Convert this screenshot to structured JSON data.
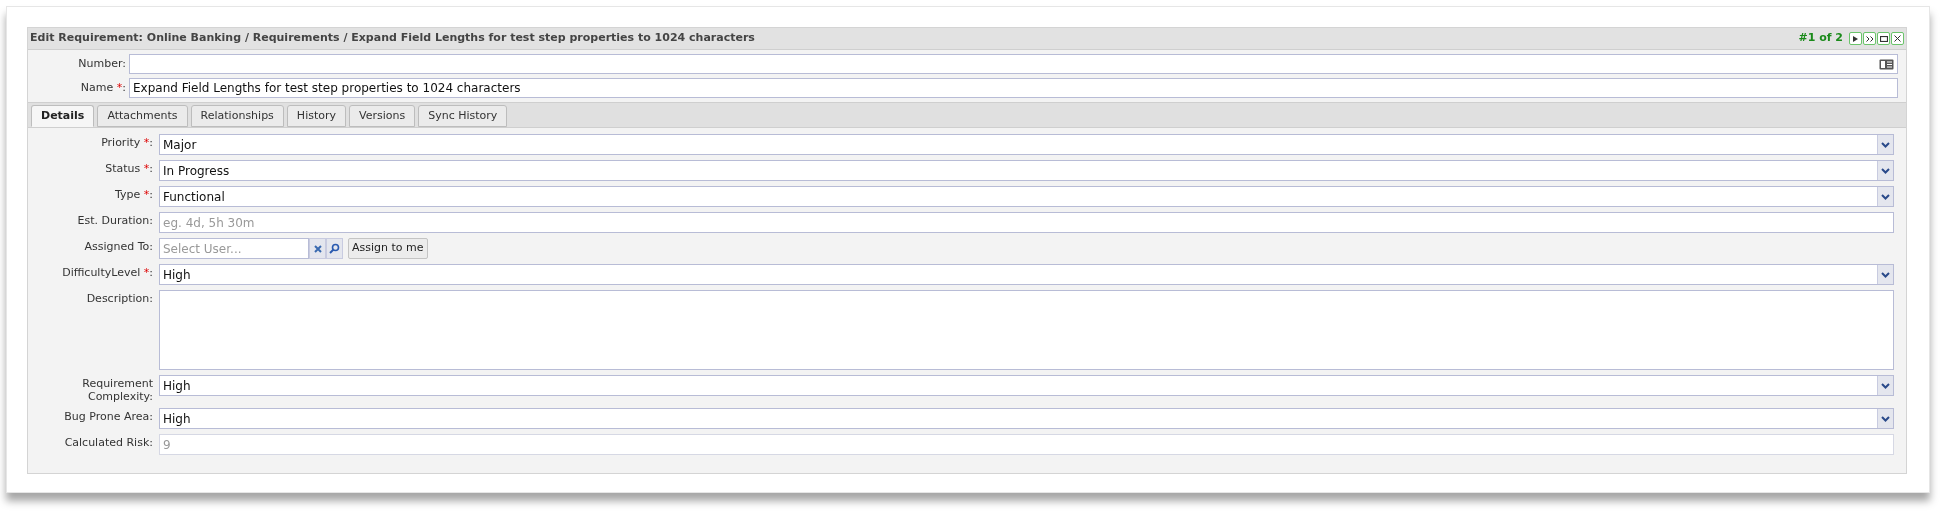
{
  "dialog": {
    "title": "Edit Requirement: Online Banking / Requirements / Expand Field Lengths for test step properties to 1024 characters",
    "counter": "#1 of 2"
  },
  "header_fields": [
    {
      "label": "Number:",
      "has_icon": true
    },
    {
      "label": "Name ",
      "asterisk": "*",
      "colon": ":",
      "value": "Expand Field Lengths for test step properties to 1024 characters",
      "has_icon": false
    }
  ],
  "tabs": [
    {
      "label": "Details",
      "selected": true
    },
    {
      "label": "Attachments",
      "selected": false
    },
    {
      "label": "Relationships",
      "selected": false
    },
    {
      "label": "History",
      "selected": false
    },
    {
      "label": "Versions",
      "selected": false
    },
    {
      "label": "Sync History",
      "selected": false
    }
  ],
  "fields": [
    {
      "kind": "select",
      "label": "Priority ",
      "asterisk": "*",
      "colon": ":",
      "value": "Major"
    },
    {
      "kind": "select",
      "label": "Status ",
      "asterisk": "*",
      "colon": ":",
      "value": "In Progress"
    },
    {
      "kind": "select",
      "label": "Type ",
      "asterisk": "*",
      "colon": ":",
      "value": "Functional"
    },
    {
      "kind": "text",
      "label": "Est. Duration:",
      "placeholder": "eg. 4d, 5h 30m"
    },
    {
      "kind": "user",
      "label": "Assigned To:",
      "placeholder": "Select User...",
      "button": "Assign to me"
    },
    {
      "kind": "select",
      "label": "DifficultyLevel ",
      "asterisk": "*",
      "colon": ":",
      "value": "High"
    },
    {
      "kind": "textarea",
      "label": "Description:"
    },
    {
      "kind": "select",
      "label": "Requirement Complexity:",
      "value": "High"
    },
    {
      "kind": "select",
      "label": "Bug Prone Area:",
      "value": "High"
    },
    {
      "kind": "readonly",
      "label": "Calculated Risk:",
      "value": "9"
    }
  ]
}
